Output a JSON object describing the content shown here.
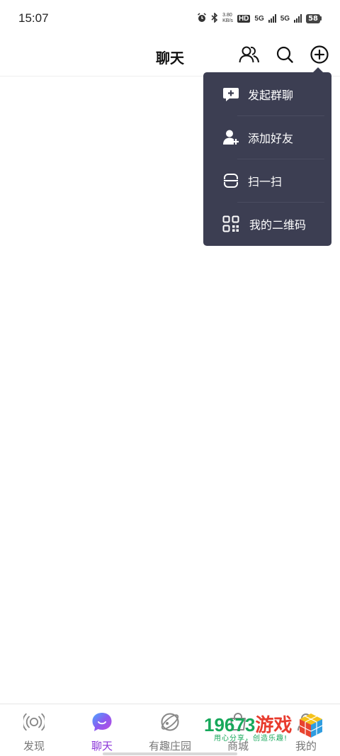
{
  "status_bar": {
    "time": "15:07",
    "net_speed_value": "3.80",
    "net_speed_unit": "KB/s",
    "hd_badge": "HD",
    "sim1_network": "5G",
    "sim2_network": "5G",
    "battery": "58"
  },
  "header": {
    "title": "聊天",
    "icons": [
      "contacts-icon",
      "search-icon",
      "add-circle-icon"
    ]
  },
  "popup_menu": {
    "items": [
      {
        "label": "发起群聊",
        "icon": "group-chat-icon"
      },
      {
        "label": "添加好友",
        "icon": "add-friend-icon"
      },
      {
        "label": "扫一扫",
        "icon": "scan-icon"
      },
      {
        "label": "我的二维码",
        "icon": "qr-code-icon"
      }
    ],
    "background": "#3c3e52",
    "text_color": "#ffffff"
  },
  "tab_bar": {
    "tabs": [
      {
        "label": "发现",
        "icon": "discover-icon",
        "active": false
      },
      {
        "label": "聊天",
        "icon": "chat-bubble-icon",
        "active": true
      },
      {
        "label": "有趣庄园",
        "icon": "planet-icon",
        "active": false
      },
      {
        "label": "商城",
        "icon": "shop-icon",
        "active": false
      },
      {
        "label": "我的",
        "icon": "profile-icon",
        "active": false
      }
    ],
    "active_color": "#8a35d8",
    "inactive_color": "#777777"
  },
  "watermark": {
    "number": "19673",
    "brand": "游戏",
    "slogan": "用心分享，创造乐趣!"
  }
}
